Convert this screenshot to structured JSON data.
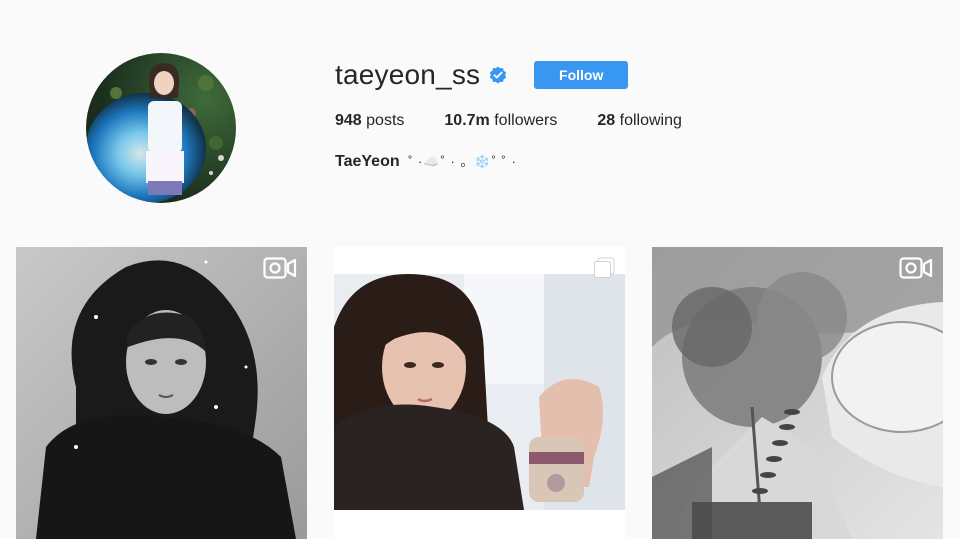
{
  "profile": {
    "username": "taeyeon_ss",
    "verified": true,
    "follow_label": "Follow",
    "stats": {
      "posts_count": "948",
      "posts_label": "posts",
      "followers_count": "10.7m",
      "followers_label": "followers",
      "following_count": "28",
      "following_label": "following"
    },
    "bio_name": "TaeYeon",
    "bio_decoration": "˚  ·☁️˚  ·  。❄️˚  ˚  ·",
    "avatar_icon": "profile-avatar"
  },
  "colors": {
    "follow_button": "#3897f0",
    "verified_badge": "#3897f0",
    "background": "#fafafa",
    "text": "#262626"
  },
  "posts": [
    {
      "type": "video",
      "icon": "video-camera-icon"
    },
    {
      "type": "multi",
      "icon": "carousel-icon"
    },
    {
      "type": "video",
      "icon": "video-camera-icon"
    }
  ]
}
